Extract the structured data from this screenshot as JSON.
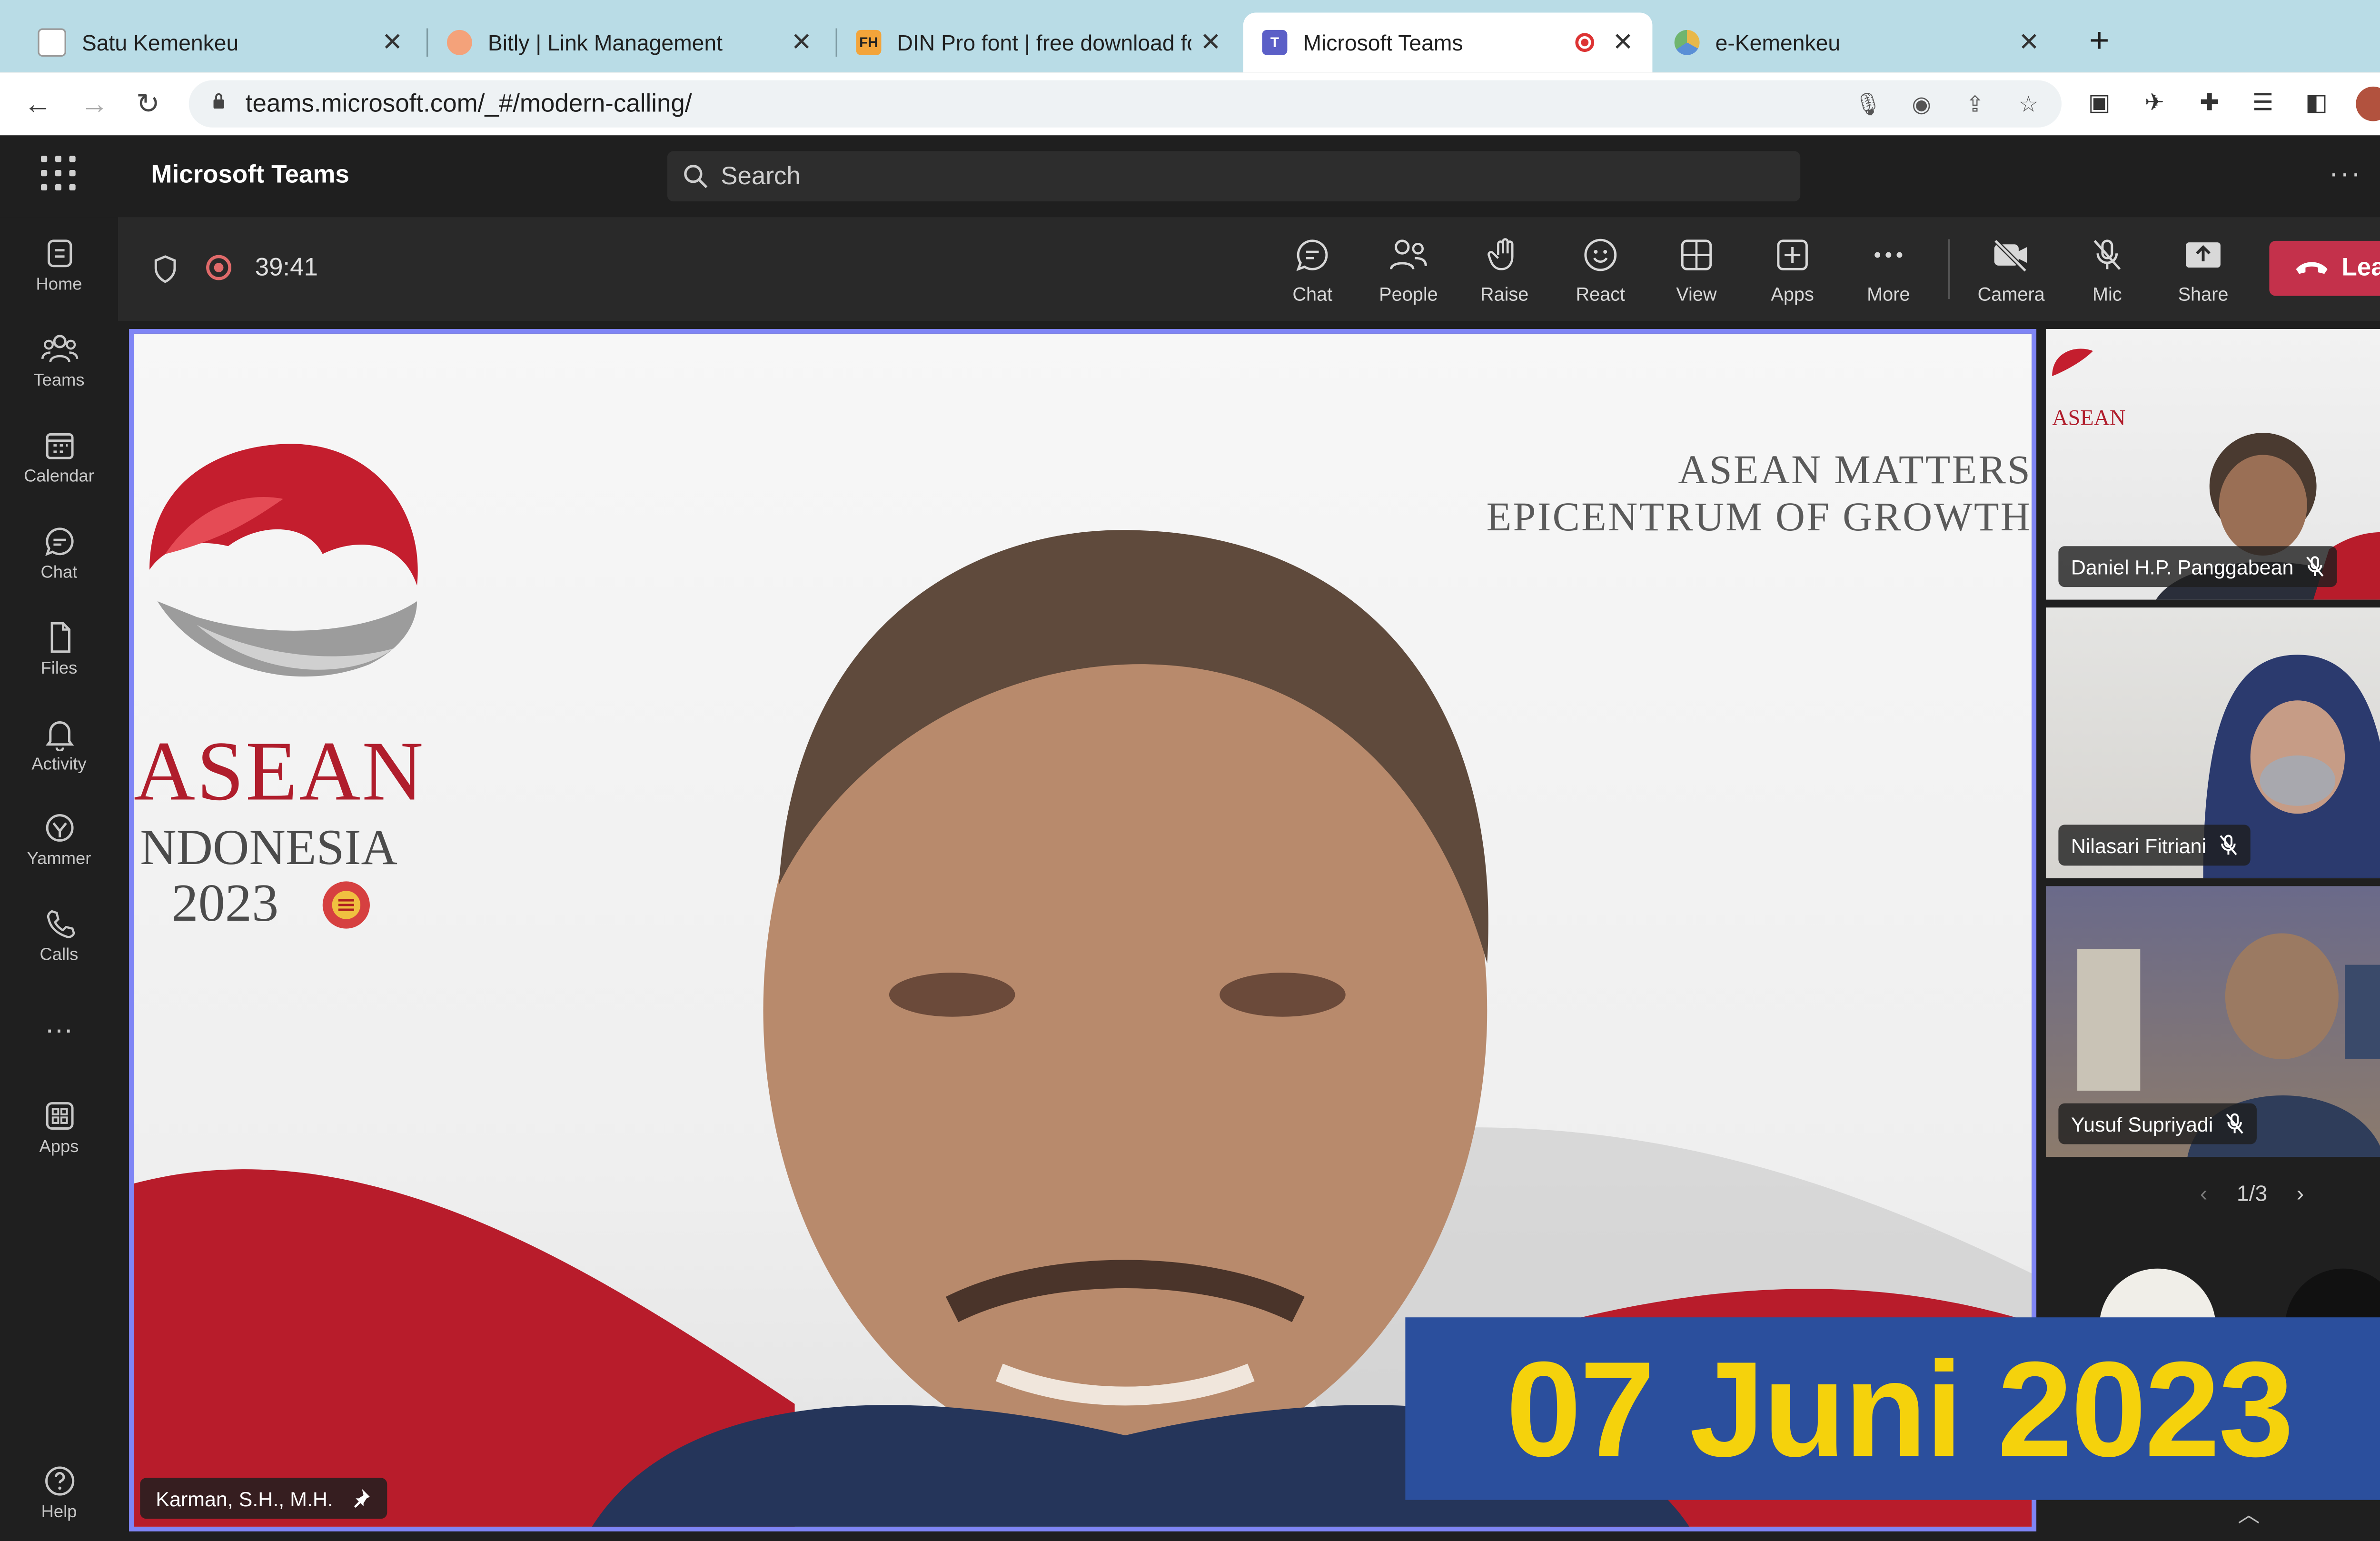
{
  "browser": {
    "tabs": [
      {
        "title": "Satu Kemenkeu",
        "favicon": "document-icon"
      },
      {
        "title": "Bitly | Link Management",
        "favicon": "bitly-icon"
      },
      {
        "title": "DIN Pro font | free download fo",
        "favicon": "fh-icon",
        "favicon_text": "FH"
      },
      {
        "title": "Microsoft Teams",
        "favicon": "teams-icon",
        "active": true,
        "recording": true
      },
      {
        "title": "e-Kemenkeu",
        "favicon": "kemenkeu-icon"
      }
    ],
    "url": "teams.microsoft.com/_#/modern-calling/",
    "accent": "#b9dce6"
  },
  "teams": {
    "app_title": "Microsoft Teams",
    "search_placeholder": "Search",
    "rail": [
      {
        "label": "Home",
        "icon": "home-icon"
      },
      {
        "label": "Teams",
        "icon": "teams-people-icon"
      },
      {
        "label": "Calendar",
        "icon": "calendar-icon"
      },
      {
        "label": "Chat",
        "icon": "chat-icon"
      },
      {
        "label": "Files",
        "icon": "file-icon"
      },
      {
        "label": "Activity",
        "icon": "bell-icon"
      },
      {
        "label": "Yammer",
        "icon": "yammer-icon"
      },
      {
        "label": "Calls",
        "icon": "phone-icon"
      },
      {
        "label": "Apps",
        "icon": "apps-icon"
      },
      {
        "label": "Help",
        "icon": "help-icon"
      }
    ],
    "meeting": {
      "timer": "39:41",
      "controls": [
        {
          "label": "Chat",
          "icon": "chat-bubble-icon"
        },
        {
          "label": "People",
          "icon": "people-icon"
        },
        {
          "label": "Raise",
          "icon": "hand-icon"
        },
        {
          "label": "React",
          "icon": "smiley-icon"
        },
        {
          "label": "View",
          "icon": "grid-icon"
        },
        {
          "label": "Apps",
          "icon": "plus-box-icon"
        },
        {
          "label": "More",
          "icon": "more-dots-icon"
        },
        {
          "label": "Camera",
          "icon": "camera-off-icon"
        },
        {
          "label": "Mic",
          "icon": "mic-off-icon"
        },
        {
          "label": "Share",
          "icon": "share-icon"
        }
      ],
      "leave_label": "Leave",
      "leave_color": "#c4314b",
      "focus_color": "#7f85f5"
    },
    "main_speaker": {
      "name": "Karman, S.H., M.H.",
      "pinned": true,
      "background": {
        "logo_word": "ASEAN",
        "logo_country": "NDONESIA",
        "logo_year": "2023",
        "tagline_1": "ASEAN MATTERS",
        "tagline_2": "EPICENTRUM OF GROWTH"
      }
    },
    "participants": [
      {
        "name": "Daniel H.P. Panggabean",
        "muted": true
      },
      {
        "name": "Nilasari Fitriani",
        "muted": true
      },
      {
        "name": "Yusuf Supriyadi",
        "muted": true
      }
    ],
    "pager": "1/3"
  },
  "overlay": {
    "date": "07 Juni 2023",
    "bg_color": "#2b4f9d",
    "text_color": "#f5d20c"
  }
}
